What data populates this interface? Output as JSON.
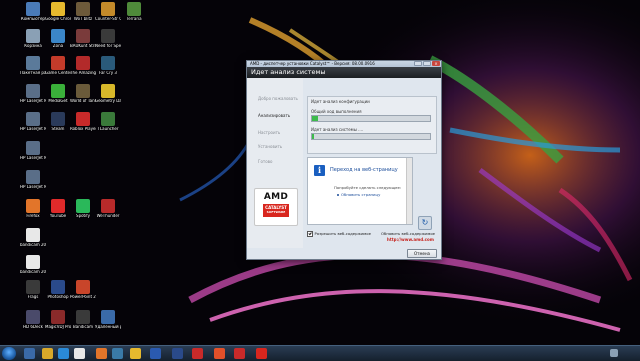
{
  "desktop_icons": [
    {
      "label": "Компьютер",
      "color": "#4a7bb8",
      "name": "computer-icon"
    },
    {
      "label": "Google Chrome",
      "color": "#e6b92e",
      "name": "chrome-icon"
    },
    {
      "label": "WoT blitz",
      "color": "#6d5a3a",
      "name": "wot-blitz-icon"
    },
    {
      "label": "Counter-Str Global Off...",
      "color": "#c48a2a",
      "name": "counter-strike-icon"
    },
    {
      "label": "Terraria",
      "color": "#4f8a3a",
      "name": "terraria-icon"
    },
    {
      "label": "Корзина",
      "color": "#8aa0b5",
      "name": "recycle-bin-icon"
    },
    {
      "label": "Zona",
      "color": "#3b86c8",
      "name": "zona-icon"
    },
    {
      "label": "BAUKunt Strike Bl...",
      "color": "#7a3b3b",
      "name": "baukunt-icon"
    },
    {
      "label": "Need for Speed Mo...",
      "color": "#3a3a3a",
      "name": "nfs-icon"
    },
    {
      "label": "Пакетная расшифро...",
      "color": "#5b7a9a",
      "name": "batch-icon"
    },
    {
      "label": "Game Center",
      "color": "#c43b2a",
      "name": "game-center-icon"
    },
    {
      "label": "The Amazing Spider-Ma...",
      "color": "#b32a2a",
      "name": "spiderman-icon"
    },
    {
      "label": "Far Cry 3",
      "color": "#2a5a7a",
      "name": "farcry3-icon"
    },
    {
      "label": "HP LaserJet M1130 MFP...",
      "color": "#5a6e88",
      "name": "hp-icon"
    },
    {
      "label": "MediaGet",
      "color": "#3ab03a",
      "name": "mediaget-icon"
    },
    {
      "label": "World of Tanks RU",
      "color": "#6a5a3a",
      "name": "wot-icon"
    },
    {
      "label": "Geometry Dash v2.11",
      "color": "#d8b82a",
      "name": "geometry-dash-icon"
    },
    {
      "label": "HP LaserJet M1130 MFP...",
      "color": "#5a6e88",
      "name": "hp-icon-2"
    },
    {
      "label": "Steam",
      "color": "#2a3a5a",
      "name": "steam-icon"
    },
    {
      "label": "Roblox Player",
      "color": "#c82a2a",
      "name": "roblox-icon"
    },
    {
      "label": "TLauncher",
      "color": "#3a7a3a",
      "name": "tlauncher-icon"
    },
    {
      "label": "HP LaserJet M1130 MFP...",
      "color": "#5a6e88",
      "name": "hp-icon-3"
    },
    {
      "label": "HP LaserJet MFP M28...",
      "color": "#5a6e88",
      "name": "hp-icon-4"
    },
    {
      "label": "Firefox",
      "color": "#e2752a",
      "name": "firefox-icon"
    },
    {
      "label": "YouTube",
      "color": "#e02a2a",
      "name": "youtube-icon"
    },
    {
      "label": "Spotify",
      "color": "#2ab85a",
      "name": "spotify-icon"
    },
    {
      "label": "WeThunder",
      "color": "#b82a2a",
      "name": "wethunder-icon"
    },
    {
      "label": "bandicam 2022-04-10...",
      "color": "#e8e8e8",
      "name": "bandicam-file-icon"
    },
    {
      "label": "bandicam 2022-04-10...",
      "color": "#e8e8e8",
      "name": "bandicam-file-icon-2"
    },
    {
      "label": "Frags",
      "color": "#3a3a3a",
      "name": "frags-icon"
    },
    {
      "label": "Photoshop",
      "color": "#2a4a8a",
      "name": "photoshop-icon"
    },
    {
      "label": "PowerPoint 2016",
      "color": "#c8452a",
      "name": "powerpoint-icon"
    },
    {
      "label": "HD 6Deck",
      "color": "#4a4a6a",
      "name": "hd6deck-icon"
    },
    {
      "label": "MagicVDJ Pro",
      "color": "#8a2a2a",
      "name": "magicvdj-icon"
    },
    {
      "label": "Bandicam",
      "color": "#3a3a3a",
      "name": "bandicam-icon"
    },
    {
      "label": "Удаленный рабочий ст...",
      "color": "#3a6aa8",
      "name": "remote-desktop-icon"
    }
  ],
  "window": {
    "title": "AMD - диспетчер установки Catalyst™ - Версия: 08.00.0916",
    "header": "Идет анализ системы",
    "steps": [
      "Добро пожаловать",
      "Анализировать",
      "Настроить",
      "Установить",
      "Готово"
    ],
    "active_step": 1,
    "analysis_caption": "Идет анализ конфигурации",
    "overall_label": "Общий ход выполнения",
    "overall_progress": 0.05,
    "current_label": "Идет анализ системы ....",
    "current_progress": 0.02,
    "browser_title": "Переход на веб-страницу",
    "browser_hint": "Попробуйте сделать следующее:",
    "browser_link": "Обновить страницу",
    "checkbox_label": "Разрешить веб-содержимое",
    "checkbox_checked": true,
    "show_web_label": "Обновить веб-содержимое",
    "url": "http://www.amd.com",
    "cancel_label": "Отмена",
    "logo_text": "AMD",
    "logo_badge": "CATALYST",
    "logo_badge_sub": "SOFTWARE",
    "close_glyph": "×"
  }
}
